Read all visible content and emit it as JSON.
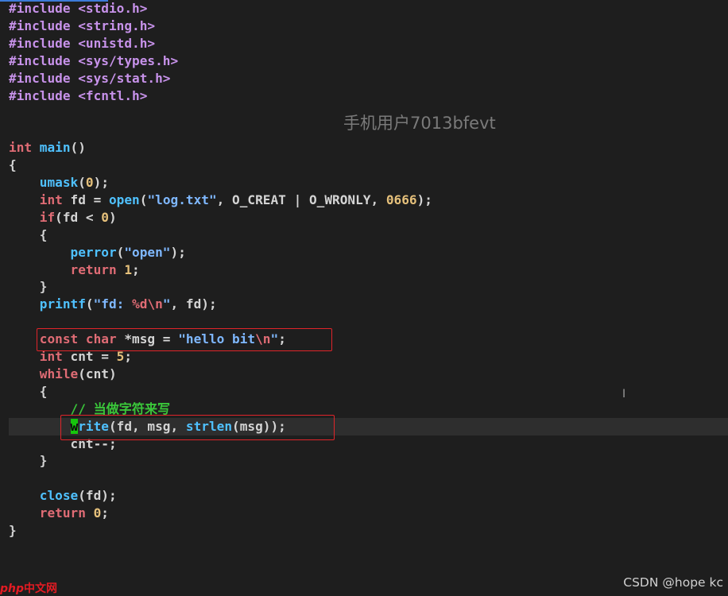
{
  "editor": {
    "lines": [
      [
        {
          "c": "t-pp",
          "t": "#include <stdio.h>"
        }
      ],
      [
        {
          "c": "t-pp",
          "t": "#include <string.h>"
        }
      ],
      [
        {
          "c": "t-pp",
          "t": "#include <unistd.h>"
        }
      ],
      [
        {
          "c": "t-pp",
          "t": "#include <sys/types.h>"
        }
      ],
      [
        {
          "c": "t-pp",
          "t": "#include <sys/stat.h>"
        }
      ],
      [
        {
          "c": "t-pp",
          "t": "#include <fcntl.h>"
        }
      ],
      [],
      [],
      [
        {
          "c": "t-kw",
          "t": "int "
        },
        {
          "c": "t-fn",
          "t": "main"
        },
        {
          "c": "t-id",
          "t": "()"
        }
      ],
      [
        {
          "c": "t-id",
          "t": "{"
        }
      ],
      [
        {
          "c": "t-id",
          "t": "    "
        },
        {
          "c": "t-fn",
          "t": "umask"
        },
        {
          "c": "t-id",
          "t": "("
        },
        {
          "c": "t-num",
          "t": "0"
        },
        {
          "c": "t-id",
          "t": ");"
        }
      ],
      [
        {
          "c": "t-id",
          "t": "    "
        },
        {
          "c": "t-kw",
          "t": "int "
        },
        {
          "c": "t-id",
          "t": "fd = "
        },
        {
          "c": "t-fn",
          "t": "open"
        },
        {
          "c": "t-id",
          "t": "("
        },
        {
          "c": "t-str",
          "t": "\"log.txt\""
        },
        {
          "c": "t-id",
          "t": ", O_CREAT | O_WRONLY, "
        },
        {
          "c": "t-num",
          "t": "0666"
        },
        {
          "c": "t-id",
          "t": ");"
        }
      ],
      [
        {
          "c": "t-id",
          "t": "    "
        },
        {
          "c": "t-kw",
          "t": "if"
        },
        {
          "c": "t-id",
          "t": "(fd < "
        },
        {
          "c": "t-num",
          "t": "0"
        },
        {
          "c": "t-id",
          "t": ")"
        }
      ],
      [
        {
          "c": "t-id",
          "t": "    {"
        }
      ],
      [
        {
          "c": "t-id",
          "t": "        "
        },
        {
          "c": "t-fn",
          "t": "perror"
        },
        {
          "c": "t-id",
          "t": "("
        },
        {
          "c": "t-str",
          "t": "\"open\""
        },
        {
          "c": "t-id",
          "t": ");"
        }
      ],
      [
        {
          "c": "t-id",
          "t": "        "
        },
        {
          "c": "t-kw",
          "t": "return "
        },
        {
          "c": "t-num",
          "t": "1"
        },
        {
          "c": "t-id",
          "t": ";"
        }
      ],
      [
        {
          "c": "t-id",
          "t": "    }"
        }
      ],
      [
        {
          "c": "t-id",
          "t": "    "
        },
        {
          "c": "t-fn",
          "t": "printf"
        },
        {
          "c": "t-id",
          "t": "("
        },
        {
          "c": "t-str",
          "t": "\"fd: "
        },
        {
          "c": "t-kw",
          "t": "%d\\n"
        },
        {
          "c": "t-str",
          "t": "\""
        },
        {
          "c": "t-id",
          "t": ", fd);"
        }
      ],
      [],
      [
        {
          "c": "t-id",
          "t": "    "
        },
        {
          "c": "t-kw",
          "t": "const char "
        },
        {
          "c": "t-id",
          "t": "*msg = "
        },
        {
          "c": "t-str",
          "t": "\"hello bit"
        },
        {
          "c": "t-kw",
          "t": "\\n"
        },
        {
          "c": "t-str",
          "t": "\""
        },
        {
          "c": "t-id",
          "t": ";"
        }
      ],
      [
        {
          "c": "t-id",
          "t": "    "
        },
        {
          "c": "t-kw",
          "t": "int "
        },
        {
          "c": "t-id",
          "t": "cnt = "
        },
        {
          "c": "t-num",
          "t": "5"
        },
        {
          "c": "t-id",
          "t": ";"
        }
      ],
      [
        {
          "c": "t-id",
          "t": "    "
        },
        {
          "c": "t-kw",
          "t": "while"
        },
        {
          "c": "t-id",
          "t": "(cnt)"
        }
      ],
      [
        {
          "c": "t-id",
          "t": "    {"
        }
      ],
      [
        {
          "c": "t-id",
          "t": "        "
        },
        {
          "c": "t-cmt",
          "t": "// 当做字符来写"
        }
      ],
      [
        {
          "c": "t-id",
          "t": "        "
        },
        {
          "c": "cursor",
          "t": "w"
        },
        {
          "c": "t-fn",
          "t": "rite"
        },
        {
          "c": "t-id",
          "t": "(fd, msg, "
        },
        {
          "c": "t-fn",
          "t": "strlen"
        },
        {
          "c": "t-id",
          "t": "(msg));"
        }
      ],
      [
        {
          "c": "t-id",
          "t": "        cnt--;"
        }
      ],
      [
        {
          "c": "t-id",
          "t": "    }"
        }
      ],
      [],
      [
        {
          "c": "t-id",
          "t": "    "
        },
        {
          "c": "t-fn",
          "t": "close"
        },
        {
          "c": "t-id",
          "t": "(fd);"
        }
      ],
      [
        {
          "c": "t-id",
          "t": "    "
        },
        {
          "c": "t-kw",
          "t": "return "
        },
        {
          "c": "t-num",
          "t": "0"
        },
        {
          "c": "t-id",
          "t": ";"
        }
      ],
      [
        {
          "c": "t-id",
          "t": "}"
        }
      ]
    ]
  },
  "overlay": {
    "watermark": "手机用户7013bfevt",
    "credit": "CSDN @hope kc",
    "site_logo": "php中文网"
  },
  "colors": {
    "background": "#1e1e1e",
    "preprocessor": "#c792ea",
    "keyword": "#e06c75",
    "function": "#4fc1ff",
    "string": "#7fb8ff",
    "number": "#e5c07b",
    "comment": "#3ac63a",
    "highlight_box": "#e0242a",
    "cursor": "#16c60c"
  }
}
